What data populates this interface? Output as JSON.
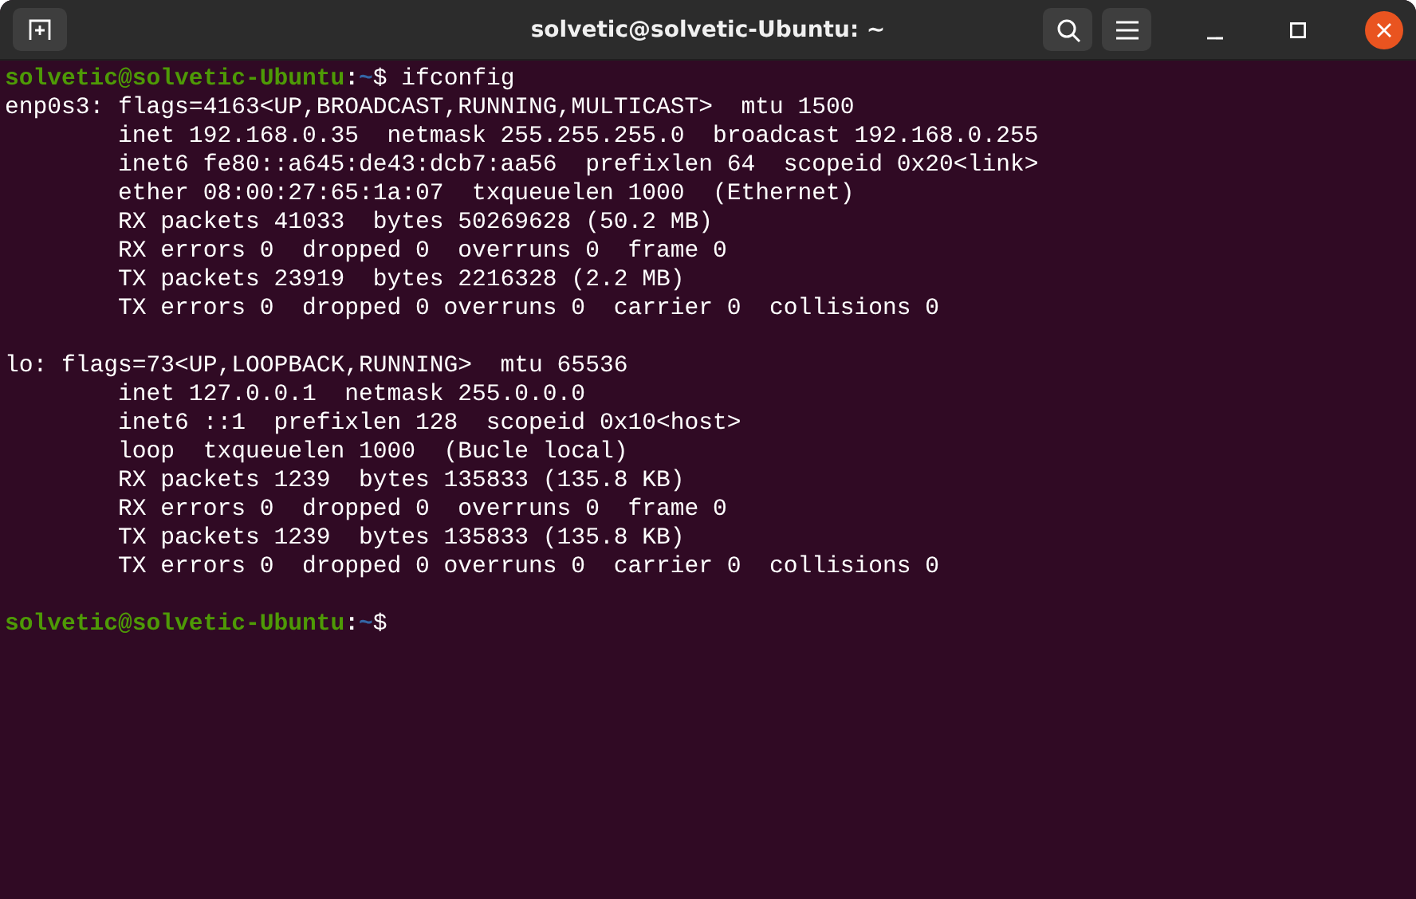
{
  "window": {
    "title": "solvetic@solvetic-Ubuntu: ~"
  },
  "terminal": {
    "lines": [
      {
        "kind": "prompt",
        "user": "solvetic@solvetic-Ubuntu",
        "separator": ":",
        "path": "~",
        "symbol": "$",
        "command": " ifconfig"
      },
      {
        "kind": "output",
        "text": "enp0s3: flags=4163<UP,BROADCAST,RUNNING,MULTICAST>  mtu 1500"
      },
      {
        "kind": "output",
        "text": "        inet 192.168.0.35  netmask 255.255.255.0  broadcast 192.168.0.255"
      },
      {
        "kind": "output",
        "text": "        inet6 fe80::a645:de43:dcb7:aa56  prefixlen 64  scopeid 0x20<link>"
      },
      {
        "kind": "output",
        "text": "        ether 08:00:27:65:1a:07  txqueuelen 1000  (Ethernet)"
      },
      {
        "kind": "output",
        "text": "        RX packets 41033  bytes 50269628 (50.2 MB)"
      },
      {
        "kind": "output",
        "text": "        RX errors 0  dropped 0  overruns 0  frame 0"
      },
      {
        "kind": "output",
        "text": "        TX packets 23919  bytes 2216328 (2.2 MB)"
      },
      {
        "kind": "output",
        "text": "        TX errors 0  dropped 0 overruns 0  carrier 0  collisions 0"
      },
      {
        "kind": "blank"
      },
      {
        "kind": "output",
        "text": "lo: flags=73<UP,LOOPBACK,RUNNING>  mtu 65536"
      },
      {
        "kind": "output",
        "text": "        inet 127.0.0.1  netmask 255.0.0.0"
      },
      {
        "kind": "output",
        "text": "        inet6 ::1  prefixlen 128  scopeid 0x10<host>"
      },
      {
        "kind": "output",
        "text": "        loop  txqueuelen 1000  (Bucle local)"
      },
      {
        "kind": "output",
        "text": "        RX packets 1239  bytes 135833 (135.8 KB)"
      },
      {
        "kind": "output",
        "text": "        RX errors 0  dropped 0  overruns 0  frame 0"
      },
      {
        "kind": "output",
        "text": "        TX packets 1239  bytes 135833 (135.8 KB)"
      },
      {
        "kind": "output",
        "text": "        TX errors 0  dropped 0 overruns 0  carrier 0  collisions 0"
      },
      {
        "kind": "blank"
      },
      {
        "kind": "prompt",
        "user": "solvetic@solvetic-Ubuntu",
        "separator": ":",
        "path": "~",
        "symbol": "$"
      }
    ]
  }
}
